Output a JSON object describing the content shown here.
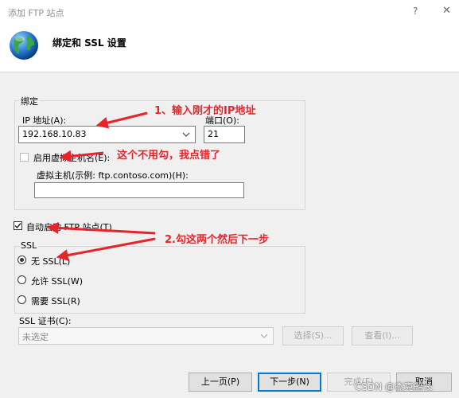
{
  "window": {
    "title": "添加 FTP 站点",
    "help_glyph": "?",
    "close_glyph": "✕",
    "header_title": "绑定和 SSL 设置",
    "header_icon": "globe-icon"
  },
  "binding": {
    "group_label": "绑定",
    "ip_label": "IP 地址(A):",
    "ip_value": "192.168.10.83",
    "port_label": "端口(O):",
    "port_value": "21",
    "vhost_checkbox_label": "启用虚拟主机名(E):",
    "vhost_checked": false,
    "vhost_hint": "虚拟主机(示例: ftp.contoso.com)(H):",
    "vhost_value": ""
  },
  "autostart": {
    "label": "自动启动 FTP 站点(T)",
    "checked": true
  },
  "ssl": {
    "group_label": "SSL",
    "options": [
      {
        "label": "无 SSL(L)",
        "selected": true
      },
      {
        "label": "允许 SSL(W)",
        "selected": false
      },
      {
        "label": "需要 SSL(R)",
        "selected": false
      }
    ],
    "cert_label": "SSL 证书(C):",
    "cert_value": "未选定",
    "select_button": "选择(S)...",
    "view_button": "查看(I)..."
  },
  "footer": {
    "prev_button": "上一页(P)",
    "next_button": "下一步(N)",
    "finish_button": "完成(F)",
    "cancel_button": "取消"
  },
  "annotations": {
    "note1": "1、输入刚才的IP地址",
    "note2": "这个不用勾，我点错了",
    "note3": "2.勾这两个然后下一步",
    "color": "#e8242a"
  },
  "watermark": "CSDN @杰克船长"
}
